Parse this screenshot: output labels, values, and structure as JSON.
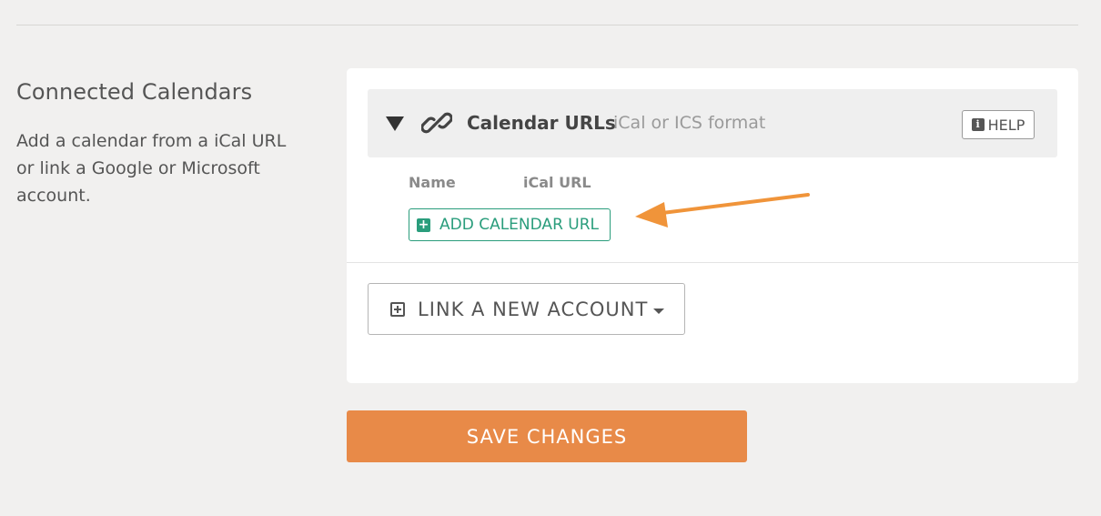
{
  "section": {
    "title": "Connected Calendars",
    "description": "Add a calendar from a iCal URL or link a Google or Microsoft account."
  },
  "calendar_urls": {
    "title": "Calendar URLs",
    "subtitle": "iCal or ICS format",
    "help_label": "HELP",
    "columns": {
      "name": "Name",
      "url": "iCal URL"
    },
    "add_button_label": "ADD CALENDAR URL"
  },
  "link_account": {
    "label": "LINK A NEW ACCOUNT"
  },
  "save": {
    "label": "SAVE CHANGES"
  },
  "colors": {
    "accent_green": "#2a9d7c",
    "save_orange": "#e88a48",
    "annotation_arrow": "#f0943a"
  },
  "icons": {
    "collapse": "triangle-down-icon",
    "link": "chain-link-icon",
    "help": "info-icon",
    "add": "plus-square-icon",
    "link_account": "plus-square-outline-icon",
    "dropdown": "caret-down-icon"
  }
}
